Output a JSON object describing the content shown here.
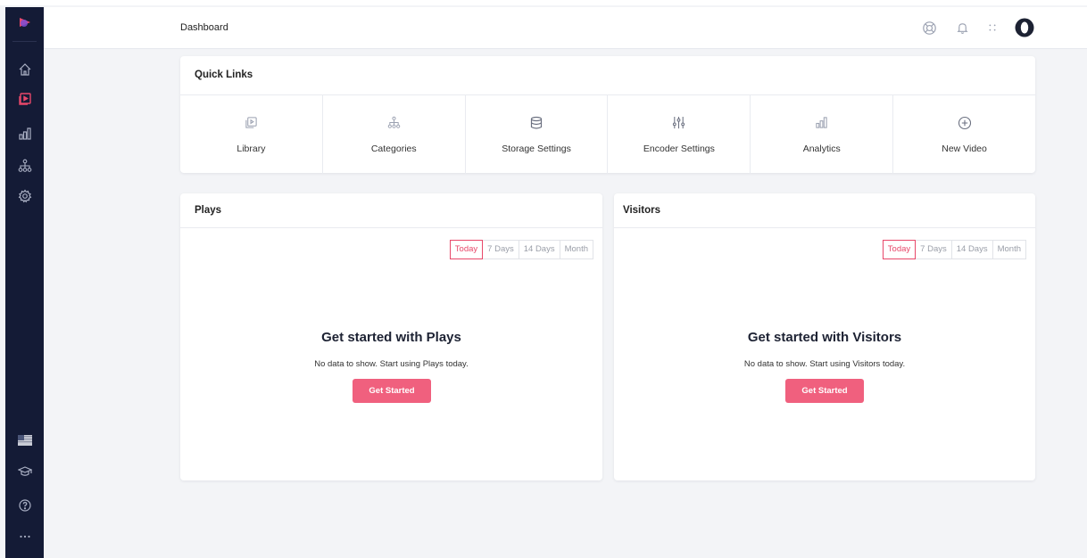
{
  "breadcrumb": "Dashboard",
  "sidebar": {
    "items": [
      {
        "icon": "logo-icon"
      },
      {
        "icon": "home-icon"
      },
      {
        "icon": "video-library-icon",
        "active": true
      },
      {
        "icon": "analytics-icon"
      },
      {
        "icon": "categories-icon"
      },
      {
        "icon": "settings-icon"
      },
      {
        "icon": "flag-icon"
      },
      {
        "icon": "graduation-cap-icon"
      },
      {
        "icon": "help-icon"
      },
      {
        "icon": "more-icon"
      }
    ]
  },
  "topbar": {
    "icons": [
      "support-icon",
      "bell-icon",
      "apps-icon",
      "avatar"
    ]
  },
  "quick_links": {
    "title": "Quick Links",
    "items": [
      {
        "label": "Library",
        "icon": "library-icon"
      },
      {
        "label": "Categories",
        "icon": "categories-icon"
      },
      {
        "label": "Storage Settings",
        "icon": "database-icon"
      },
      {
        "label": "Encoder Settings",
        "icon": "sliders-icon"
      },
      {
        "label": "Analytics",
        "icon": "analytics-icon"
      },
      {
        "label": "New Video",
        "icon": "plus-circle-icon"
      }
    ]
  },
  "plays": {
    "title": "Plays",
    "ranges": [
      "Today",
      "7 Days",
      "14 Days",
      "Month"
    ],
    "selected_range": "Today",
    "empty_title": "Get started with Plays",
    "empty_text": "No data to show. Start using Plays today.",
    "button": "Get Started"
  },
  "visitors": {
    "title": "Visitors",
    "ranges": [
      "Today",
      "7 Days",
      "14 Days",
      "Month"
    ],
    "selected_range": "Today",
    "empty_title": "Get started with Visitors",
    "empty_text": "No data to show. Start using Visitors today.",
    "button": "Get Started"
  },
  "colors": {
    "sidebar": "#141b36",
    "accent": "#e8486a",
    "button": "#f0607e"
  }
}
